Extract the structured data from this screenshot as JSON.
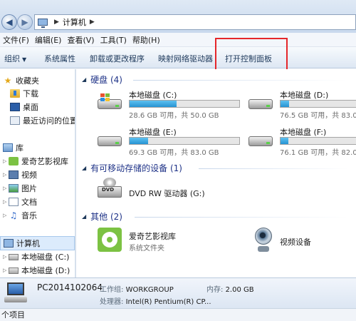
{
  "address": {
    "crumb": "计算机"
  },
  "menu": [
    "文件(F)",
    "编辑(E)",
    "查看(V)",
    "工具(T)",
    "帮助(H)"
  ],
  "toolbar": {
    "organize": "组织",
    "system_props": "系统属性",
    "uninstall": "卸载或更改程序",
    "map_drive": "映射网络驱动器",
    "control_panel": "打开控制面板"
  },
  "sidebar": {
    "favorites": "收藏夹",
    "downloads": "下载",
    "desktop": "桌面",
    "recent": "最近访问的位置",
    "library": "库",
    "iqiyi_lib": "爱奇艺影视库",
    "videos": "视频",
    "pictures": "图片",
    "documents": "文档",
    "music": "音乐",
    "computer": "计算机",
    "disk_c": "本地磁盘 (C:)",
    "disk_d": "本地磁盘 (D:)"
  },
  "groups": {
    "hard_disks": "硬盘 (4)",
    "removable": "有可移动存储的设备 (1)",
    "other": "其他 (2)"
  },
  "drives": [
    {
      "name": "本地磁盘 (C:)",
      "free": "28.6 GB 可用，共 50.0 GB",
      "used_fraction": 0.43
    },
    {
      "name": "本地磁盘 (D:)",
      "free": "76.5 GB 可用，共 83.0",
      "used_fraction": 0.08
    },
    {
      "name": "本地磁盘 (E:)",
      "free": "69.3 GB 可用，共 83.0 GB",
      "used_fraction": 0.17
    },
    {
      "name": "本地磁盘 (F:)",
      "free": "76.1 GB 可用，共 82.0",
      "used_fraction": 0.07
    }
  ],
  "dvd": {
    "name": "DVD RW 驱动器 (G:)",
    "badge": "DVD"
  },
  "other_items": {
    "iqiyi_name": "爱奇艺影视库",
    "iqiyi_sub": "系统文件夹",
    "camera_name": "视频设备"
  },
  "details": {
    "pc_name": "PC2014102064",
    "workgroup_label": "工作组:",
    "workgroup": "WORKGROUP",
    "memory_label": "内存:",
    "memory": "2.00 GB",
    "cpu_label": "处理器:",
    "cpu": "Intel(R) Pentium(R) CP..."
  },
  "status": "个项目",
  "colors": {
    "highlight": "#e5262a",
    "drive_fill": "#2693d3",
    "group_title": "#1e3287"
  }
}
